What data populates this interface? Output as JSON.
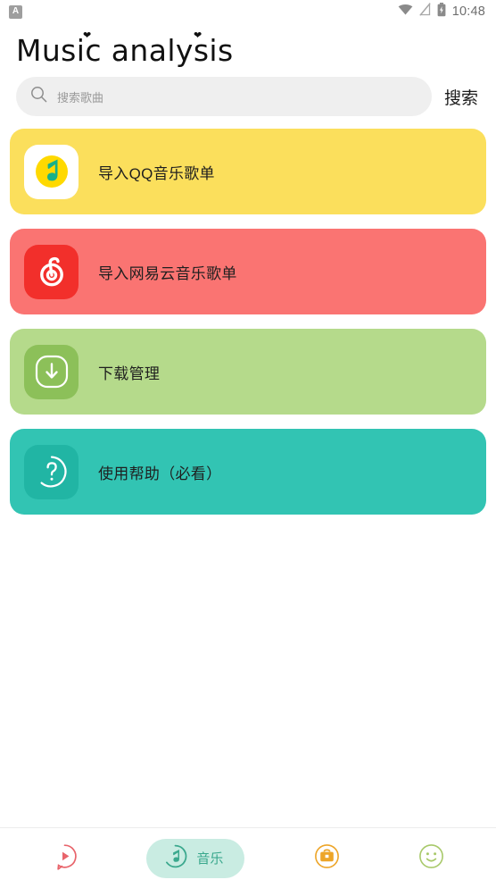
{
  "status_bar": {
    "notification_badge": "A",
    "notification_icon": "app-notification-icon",
    "wifi_icon": "wifi-icon",
    "signal_icon": "signal-off-icon",
    "battery_icon": "battery-charging-icon",
    "time": "10:48"
  },
  "header": {
    "title": "Music analysis"
  },
  "search": {
    "icon": "search-icon",
    "placeholder": "搜索歌曲",
    "value": "",
    "button_label": "搜索"
  },
  "cards": [
    {
      "label": "导入QQ音乐歌单",
      "icon": "qq-music-icon",
      "bg": "#fbdf5c",
      "tile_bg": "#ffffff"
    },
    {
      "label": "导入网易云音乐歌单",
      "icon": "netease-music-icon",
      "bg": "#fa7472",
      "tile_bg": "#f22f2b"
    },
    {
      "label": "下载管理",
      "icon": "download-icon",
      "bg": "#b5da8b",
      "tile_bg": "#8cc059"
    },
    {
      "label": "使用帮助（必看）",
      "icon": "help-question-icon",
      "bg": "#32c4b3",
      "tile_bg": "#21b5a4"
    }
  ],
  "bottom_nav": {
    "items": [
      {
        "label": "",
        "icon": "play-bubble-icon",
        "color": "#e8646b",
        "active": false
      },
      {
        "label": "音乐",
        "icon": "music-note-icon",
        "color": "#3aa88d",
        "active": true
      },
      {
        "label": "",
        "icon": "toolbox-icon",
        "color": "#eda528",
        "active": false
      },
      {
        "label": "",
        "icon": "smiley-face-icon",
        "color": "#a8c96a",
        "active": false
      }
    ]
  },
  "colors": {
    "accent_teal": "#32c4b3",
    "active_pill": "#c9ece2",
    "search_bg": "#efefef",
    "text_dark": "#1f1f1f"
  }
}
